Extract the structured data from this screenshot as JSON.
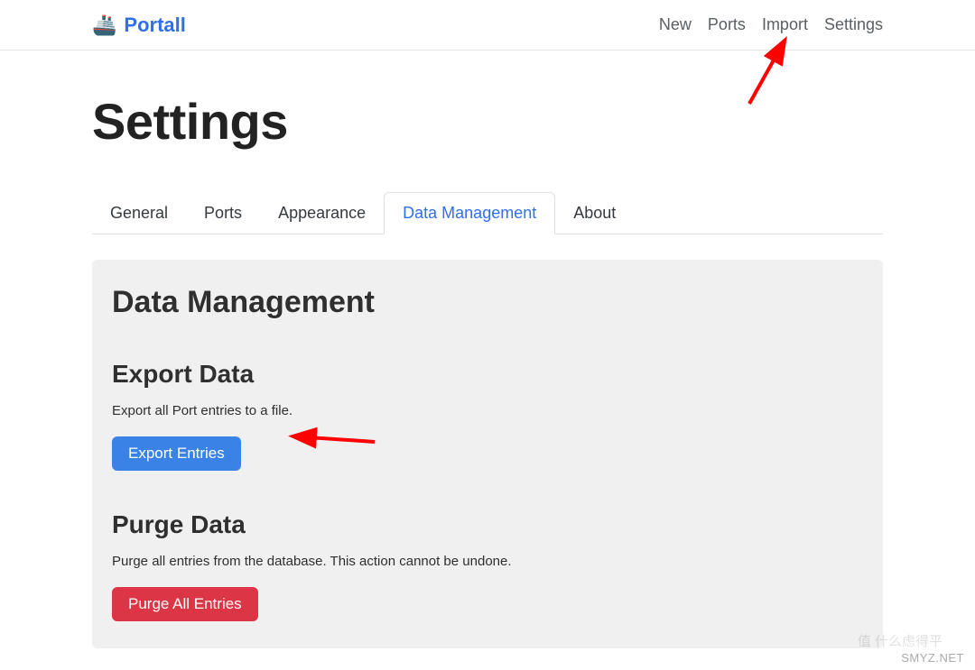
{
  "brand": {
    "emoji": "🚢",
    "name": "Portall"
  },
  "nav": {
    "new": "New",
    "ports": "Ports",
    "import": "Import",
    "settings": "Settings"
  },
  "page": {
    "title": "Settings"
  },
  "tabs": {
    "general": "General",
    "ports": "Ports",
    "appearance": "Appearance",
    "data": "Data Management",
    "about": "About"
  },
  "panel": {
    "heading": "Data Management",
    "export": {
      "title": "Export Data",
      "desc": "Export all Port entries to a file.",
      "button": "Export Entries"
    },
    "purge": {
      "title": "Purge Data",
      "desc": "Purge all entries from the database. This action cannot be undone.",
      "button": "Purge All Entries"
    }
  },
  "watermark": {
    "line1": "值 什么虑得平",
    "line2": "SMYZ.NET"
  }
}
